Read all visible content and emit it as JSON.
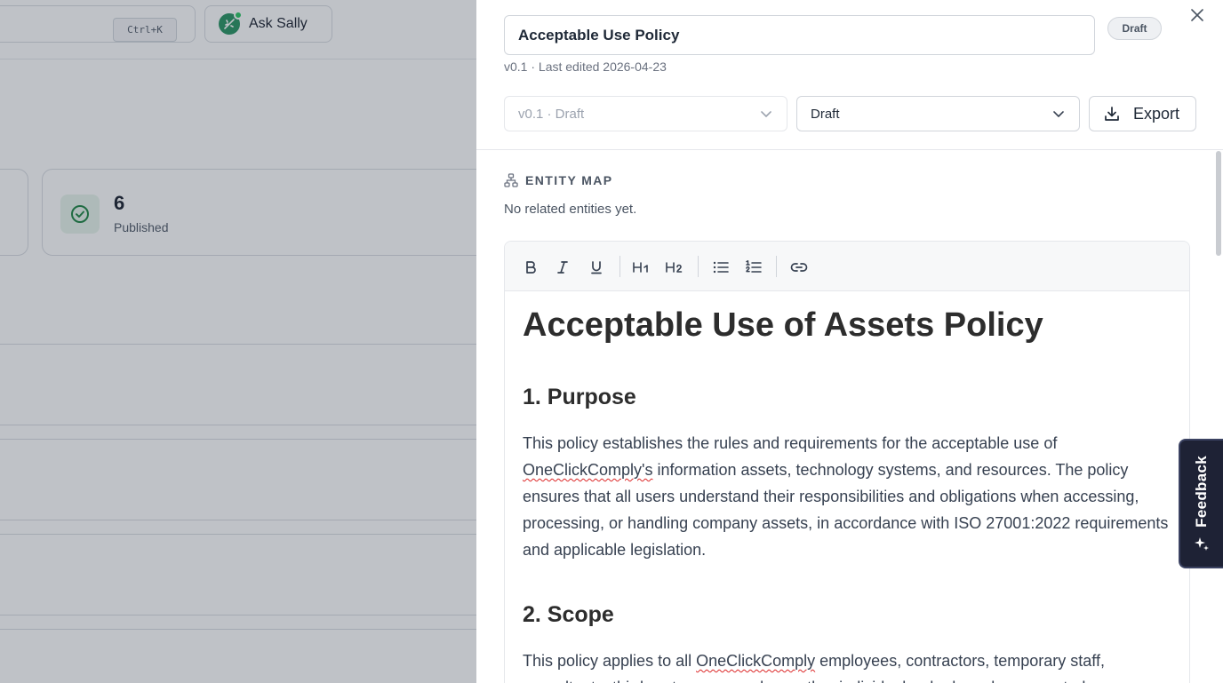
{
  "background": {
    "search_shortcut": "Ctrl+K",
    "ask_button_label": "Ask Sally",
    "stat_card": {
      "value": "6",
      "label": "Published"
    }
  },
  "drawer": {
    "title_value": "Acceptable Use Policy",
    "status_badge": "Draft",
    "meta": "v0.1 · Last edited 2026-04-23",
    "version_select": "v0.1 · Draft",
    "status_select": "Draft",
    "export_label": "Export",
    "entity_map": {
      "title": "ENTITY MAP",
      "empty_text": "No related entities yet."
    },
    "toolbar": {
      "buttons": [
        "bold-icon",
        "italic-icon",
        "underline-icon",
        "heading-1-icon",
        "heading-2-icon",
        "bullet-list-icon",
        "numbered-list-icon",
        "link-icon"
      ]
    },
    "document": {
      "title": "Acceptable Use of Assets Policy",
      "section1_heading": "1. Purpose",
      "section1_text_a": "This policy establishes the rules and requirements for the acceptable use of ",
      "section1_brand": "OneClickComply's",
      "section1_text_b": " information assets, technology systems, and resources. The policy ensures that all users understand their responsibilities and obligations when accessing, processing, or handling company assets, in accordance with ISO 27001:2022 requirements and applicable legislation.",
      "section2_heading": "2. Scope",
      "section2_text_a": "This policy applies to all ",
      "section2_brand": "OneClickComply",
      "section2_text_b": " employees, contractors, temporary staff, consultants, third-party users, and any other individuals who have been granted access."
    }
  },
  "feedback_label": "Feedback",
  "colors": {
    "accent_green": "#1f8f5c",
    "feedback_bg": "#1e2235",
    "overlay": "rgba(55,65,81,0.32)"
  }
}
